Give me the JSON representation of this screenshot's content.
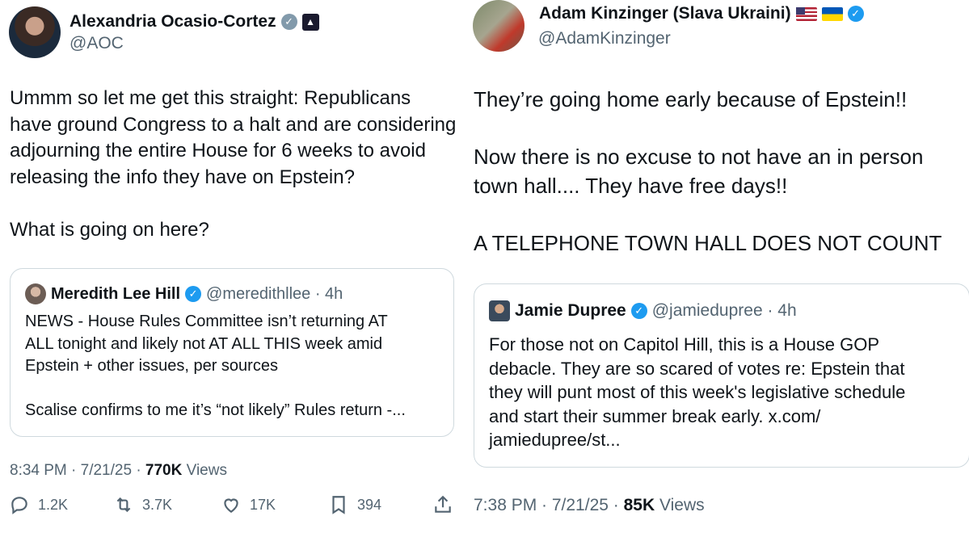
{
  "left_tweet": {
    "author_name": "Alexandria Ocasio-Cortez",
    "handle": "@AOC",
    "verified_icon": "gray-check-badge-icon",
    "affiliate_icon": "capitol-icon",
    "text": "Ummm so let me get this straight: Republicans\nhave ground Congress to a halt and are considering\nadjourning the entire House for 6 weeks to avoid\nreleasing the info they have on Epstein?\n\nWhat is going on here?",
    "quote": {
      "author_name": "Meredith Lee Hill",
      "handle": "@meredithllee · 4h",
      "text": "NEWS - House Rules Committee isn’t returning AT\nALL tonight and likely not AT ALL THIS week amid\nEpstein + other issues, per sources\n\nScalise confirms to me it’s “not likely” Rules return -..."
    },
    "time_date": "8:34 PM · 7/21/25 · ",
    "views_count": "770K",
    "views_label": " Views",
    "actions": {
      "replies": "1.2K",
      "reposts": "3.7K",
      "likes": "17K",
      "bookmarks": "394"
    }
  },
  "right_tweet": {
    "author_name": "Adam Kinzinger (Slava Ukraini)",
    "handle": "@AdamKinzinger",
    "flags": [
      "us-flag-icon",
      "ukraine-flag-icon"
    ],
    "verified_icon": "blue-check-badge-icon",
    "text": "They’re going home early because of Epstein!!\n\nNow there is no excuse to not have an in person\ntown hall.... They have free days!!\n\nA TELEPHONE TOWN HALL DOES NOT COUNT",
    "quote": {
      "author_name": "Jamie Dupree",
      "handle": "@jamiedupree · 4h",
      "text": "For those not on Capitol Hill, this is a House GOP\ndebacle.  They are so scared of votes re: Epstein that\nthey will punt most of this week's legislative schedule\nand start their summer break early. x.com/\njamiedupree/st..."
    },
    "time_date": "7:38 PM · 7/21/25 · ",
    "views_count": "85K",
    "views_label": " Views"
  },
  "colors": {
    "text": "#0f1419",
    "secondary": "#536471",
    "verified_blue": "#1d9bf0",
    "verified_gray": "#829aab",
    "border": "#cfd9de"
  }
}
